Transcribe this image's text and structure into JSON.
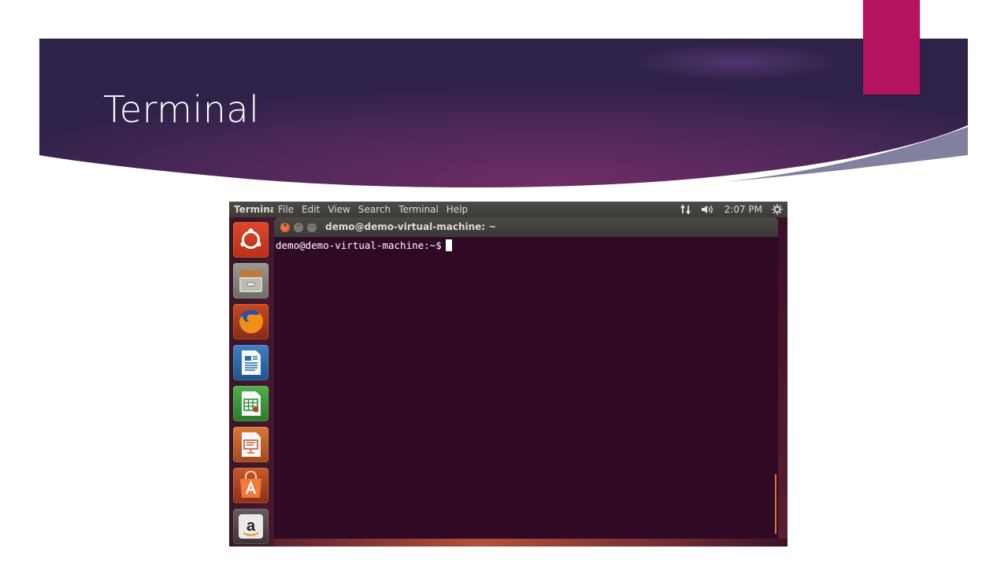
{
  "slide": {
    "title": "Terminal",
    "accent_color": "#b5135f"
  },
  "topbar": {
    "app_name": "Terminal",
    "menu": [
      "File",
      "Edit",
      "View",
      "Search",
      "Terminal",
      "Help"
    ],
    "time": "2:07 PM",
    "icons": [
      "network-icon",
      "volume-icon",
      "gear-icon"
    ]
  },
  "launcher": {
    "items": [
      {
        "name": "dash-icon",
        "color": "#e05a2a"
      },
      {
        "name": "files-icon",
        "color": "#8a8a84"
      },
      {
        "name": "firefox-icon",
        "color": "#f07a1a"
      },
      {
        "name": "writer-icon",
        "color": "#2a6fb0"
      },
      {
        "name": "calc-icon",
        "color": "#3aa03a"
      },
      {
        "name": "impress-icon",
        "color": "#d06a20"
      },
      {
        "name": "software-center-icon",
        "color": "#e8612a"
      },
      {
        "name": "amazon-icon",
        "color": "#d0d0d0"
      }
    ]
  },
  "window": {
    "title": "demo@demo-virtual-machine: ~",
    "close_glyph": "×",
    "min_glyph": "–",
    "max_glyph": "□"
  },
  "terminal": {
    "prompt": "demo@demo-virtual-machine:~$",
    "background": "#300a24"
  }
}
